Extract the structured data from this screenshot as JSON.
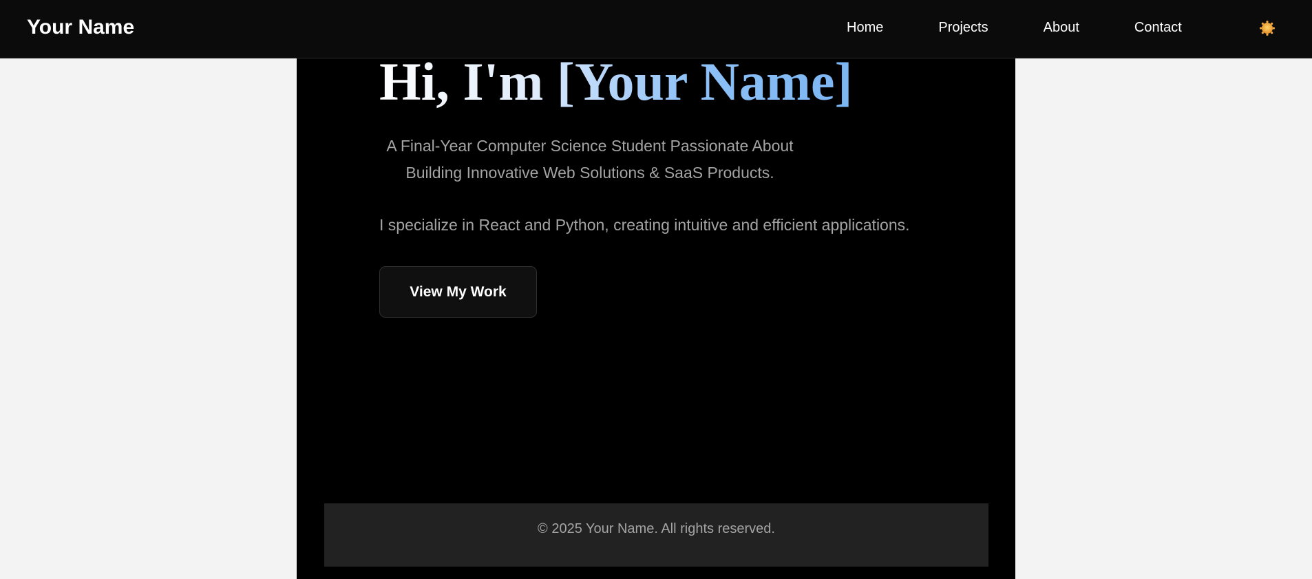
{
  "header": {
    "brand": "Your Name",
    "nav": [
      {
        "label": "Home"
      },
      {
        "label": "Projects"
      },
      {
        "label": "About"
      },
      {
        "label": "Contact"
      }
    ],
    "theme_toggle_icon": "sun-icon"
  },
  "hero": {
    "greeting": "Hi, I'm ",
    "name": "[Your Name]",
    "subtitle": "A Final-Year Computer Science Student Passionate About Building Innovative Web Solutions & SaaS Products.",
    "specialize": "I specialize in React and Python, creating intuitive and efficient applications.",
    "cta_label": "View My Work"
  },
  "footer": {
    "text": "© 2025 Your Name. All rights reserved."
  },
  "colors": {
    "nav_background": "#0b0b0b",
    "page_background": "#f3f3f3",
    "content_background": "#000000",
    "footer_background": "#222222",
    "name_gradient_end": "#7bb5f3",
    "muted_text": "#a4a4a4",
    "sun": "#f0a43c"
  }
}
